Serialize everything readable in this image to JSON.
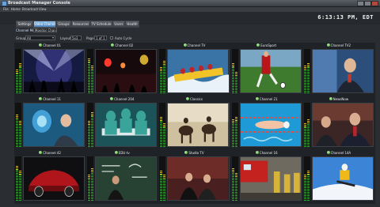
{
  "window": {
    "title": "Broadcast Manager Console",
    "icon": "broadcast-icon"
  },
  "menu": [
    "File",
    "Home",
    "Broadcast",
    "View"
  ],
  "clock": "6:13:13 PM, EDT",
  "tabs": [
    {
      "label": "Settings",
      "active": false
    },
    {
      "label": "Video Channels",
      "active": true
    },
    {
      "label": "Groups",
      "active": false
    },
    {
      "label": "Resources",
      "active": false
    },
    {
      "label": "TV Schedule",
      "active": false
    },
    {
      "label": "Users",
      "active": false
    },
    {
      "label": "Health",
      "active": false
    }
  ],
  "subbar": {
    "label": "Channel Mosaic",
    "select": "Monitor Channels"
  },
  "filters": {
    "group_label": "Group",
    "group_value": "All",
    "layout_label": "Layout",
    "layout_value": "5x3",
    "page_label": "Page",
    "page_value": "1 of 1",
    "autocycle_label": "Auto Cycle"
  },
  "status_color": "#3c9a2a",
  "channels": [
    {
      "label": "Channel 01",
      "scene": "concert"
    },
    {
      "label": "Channel 02",
      "scene": "crowd-night"
    },
    {
      "label": "Channel TV",
      "scene": "rafting"
    },
    {
      "label": "EuroSport",
      "scene": "soccer"
    },
    {
      "label": "Channel TV2",
      "scene": "speaker"
    },
    {
      "label": "Channel 11",
      "scene": "doctor-lab"
    },
    {
      "label": "Channel 204",
      "scene": "surgery"
    },
    {
      "label": "Classics",
      "scene": "horses"
    },
    {
      "label": "Channel 21",
      "scene": "swimming"
    },
    {
      "label": "NewsNow",
      "scene": "anchors"
    },
    {
      "label": "Channel 42",
      "scene": "car"
    },
    {
      "label": "EDU-tv",
      "scene": "blackboard"
    },
    {
      "label": "Studio TV",
      "scene": "studio"
    },
    {
      "label": "Channel 16",
      "scene": "firefighters"
    },
    {
      "label": "Channel 14A",
      "scene": "skier"
    }
  ],
  "meters": [
    [
      0.55,
      0.7
    ],
    [
      0.8,
      0.65
    ],
    [
      0.6,
      0.75
    ],
    [
      0.7,
      0.5
    ],
    [
      0.65,
      0.7
    ],
    [
      0.75,
      0.6
    ],
    [
      0.6,
      0.8
    ],
    [
      0.7,
      0.55
    ],
    [
      0.65,
      0.7
    ],
    [
      0.55,
      0.65
    ],
    [
      0.8,
      0.7
    ],
    [
      0.6,
      0.75
    ],
    [
      0.7,
      0.6
    ],
    [
      0.75,
      0.65
    ],
    [
      0.6,
      0.7
    ]
  ]
}
